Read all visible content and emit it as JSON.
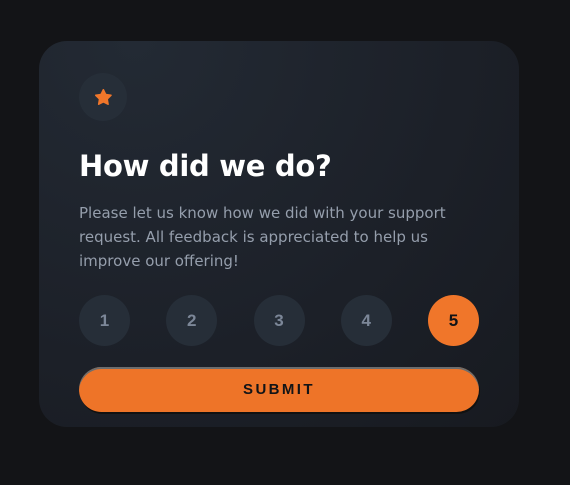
{
  "card": {
    "icon": "star-icon",
    "title": "How did we do?",
    "description": "Please let us know how we did with your support request. All feedback is appreciated to help us improve our offering!",
    "ratings": [
      "1",
      "2",
      "3",
      "4",
      "5"
    ],
    "selected_rating": "5",
    "submit_label": "SUBMIT"
  },
  "colors": {
    "background": "#131417",
    "card": "#1f242c",
    "accent": "#f0762a",
    "rating_bg": "#262e38",
    "rating_text": "#7c8798",
    "title": "#ffffff",
    "description": "#959eac"
  }
}
